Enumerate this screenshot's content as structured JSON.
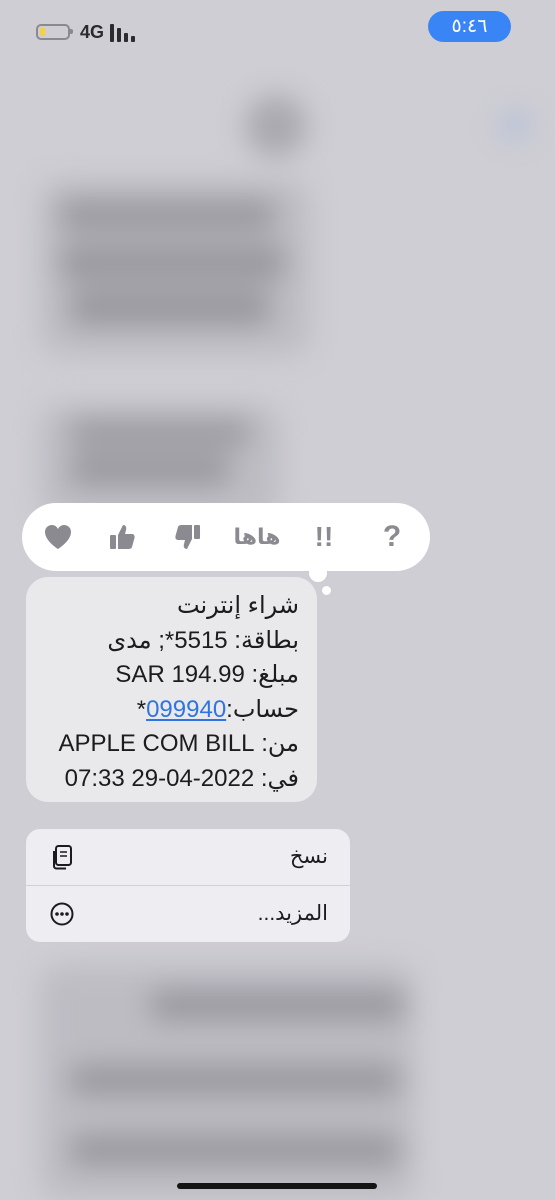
{
  "status_bar": {
    "time": "٥:٤٦",
    "network": "4G",
    "battery_level": 0.2,
    "battery_color": "#f5d142",
    "time_pill_color": "#3a85f5"
  },
  "reactions": [
    {
      "icon": "heart-icon"
    },
    {
      "icon": "thumbs-up-icon"
    },
    {
      "icon": "thumbs-down-icon"
    },
    {
      "icon": "haha-icon",
      "label": "هاها"
    },
    {
      "icon": "exclamation-icon",
      "label": "!!"
    },
    {
      "icon": "question-icon",
      "label": "?"
    }
  ],
  "message": {
    "line1": "شراء إنترنت",
    "line2": "بطاقة: 5515*; مدى",
    "line3": "مبلغ: SAR 194.99",
    "line4_prefix": "حساب:",
    "line4_link": "099940",
    "line4_suffix": "*",
    "line5": "من: APPLE COM BILL",
    "line6": "في: 2022-04-29 07:33"
  },
  "menu": {
    "copy_label": "نسخ",
    "more_label": "المزيد..."
  }
}
